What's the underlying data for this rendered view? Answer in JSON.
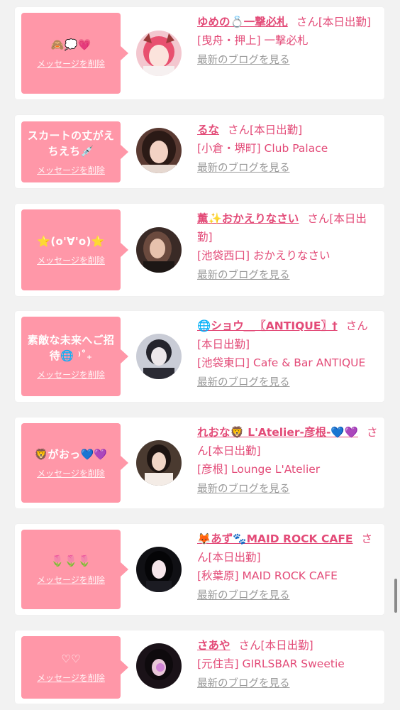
{
  "colors": {
    "accent": "#e34b78",
    "bubble": "#ff97a8",
    "link_gray": "#999999",
    "background": "#f2f2f2"
  },
  "cards": [
    {
      "bubble_text": "🙈💭💗",
      "delete_label": "メッセージを削除",
      "name": "ゆめの💍一撃必札",
      "status": "さん[本日出勤]",
      "shop": "[曳舟・押上] 一撃必札",
      "blog_link": "最新のブログを見る",
      "avatar_icon": "avatar-photo-pink-hair"
    },
    {
      "bubble_text": "スカートの丈がえちえち💉",
      "delete_label": "メッセージを削除",
      "name": "るな",
      "status": "さん[本日出勤]",
      "shop": "[小倉・堺町] Club Palace",
      "blog_link": "最新のブログを見る",
      "avatar_icon": "avatar-photo"
    },
    {
      "bubble_text": "⭐(o'∀'o)⭐",
      "delete_label": "メッセージを削除",
      "name": "薫✨おかえりなさい",
      "status": "さん[本日出勤]",
      "shop": "[池袋西口] おかえりなさい",
      "blog_link": "最新のブログを見る",
      "avatar_icon": "avatar-photo"
    },
    {
      "bubble_text": "素敵な未来へご招待🌐 ⁾˚₊",
      "delete_label": "メッセージを削除",
      "name": "🌐ショウ＿〖ANTIQUE〗†",
      "status": "さん[本日出勤]",
      "shop": "[池袋東口] Cafe & Bar ANTIQUE",
      "blog_link": "最新のブログを見る",
      "avatar_icon": "avatar-photo"
    },
    {
      "bubble_text": "🦁がおっ💙💜",
      "delete_label": "メッセージを削除",
      "name": "れおな🦁 L'Atelier-彦根-💙💜",
      "status": "さん[本日出勤]",
      "shop": "[彦根] Lounge L'Atelier",
      "blog_link": "最新のブログを見る",
      "avatar_icon": "avatar-photo"
    },
    {
      "bubble_text": "🌷🌷🌷",
      "delete_label": "メッセージを削除",
      "name": "🦊あず🐾MAID ROCK CAFE",
      "status": "さん[本日出勤]",
      "shop": "[秋葉原] MAID ROCK CAFE",
      "blog_link": "最新のブログを見る",
      "avatar_icon": "avatar-photo"
    },
    {
      "bubble_text": "♡♡",
      "delete_label": "メッセージを削除",
      "name": "さあや",
      "status": "さん[本日出勤]",
      "shop": "[元住吉] GIRLSBAR Sweetie",
      "blog_link": "最新のブログを見る",
      "avatar_icon": "avatar-photo"
    }
  ]
}
